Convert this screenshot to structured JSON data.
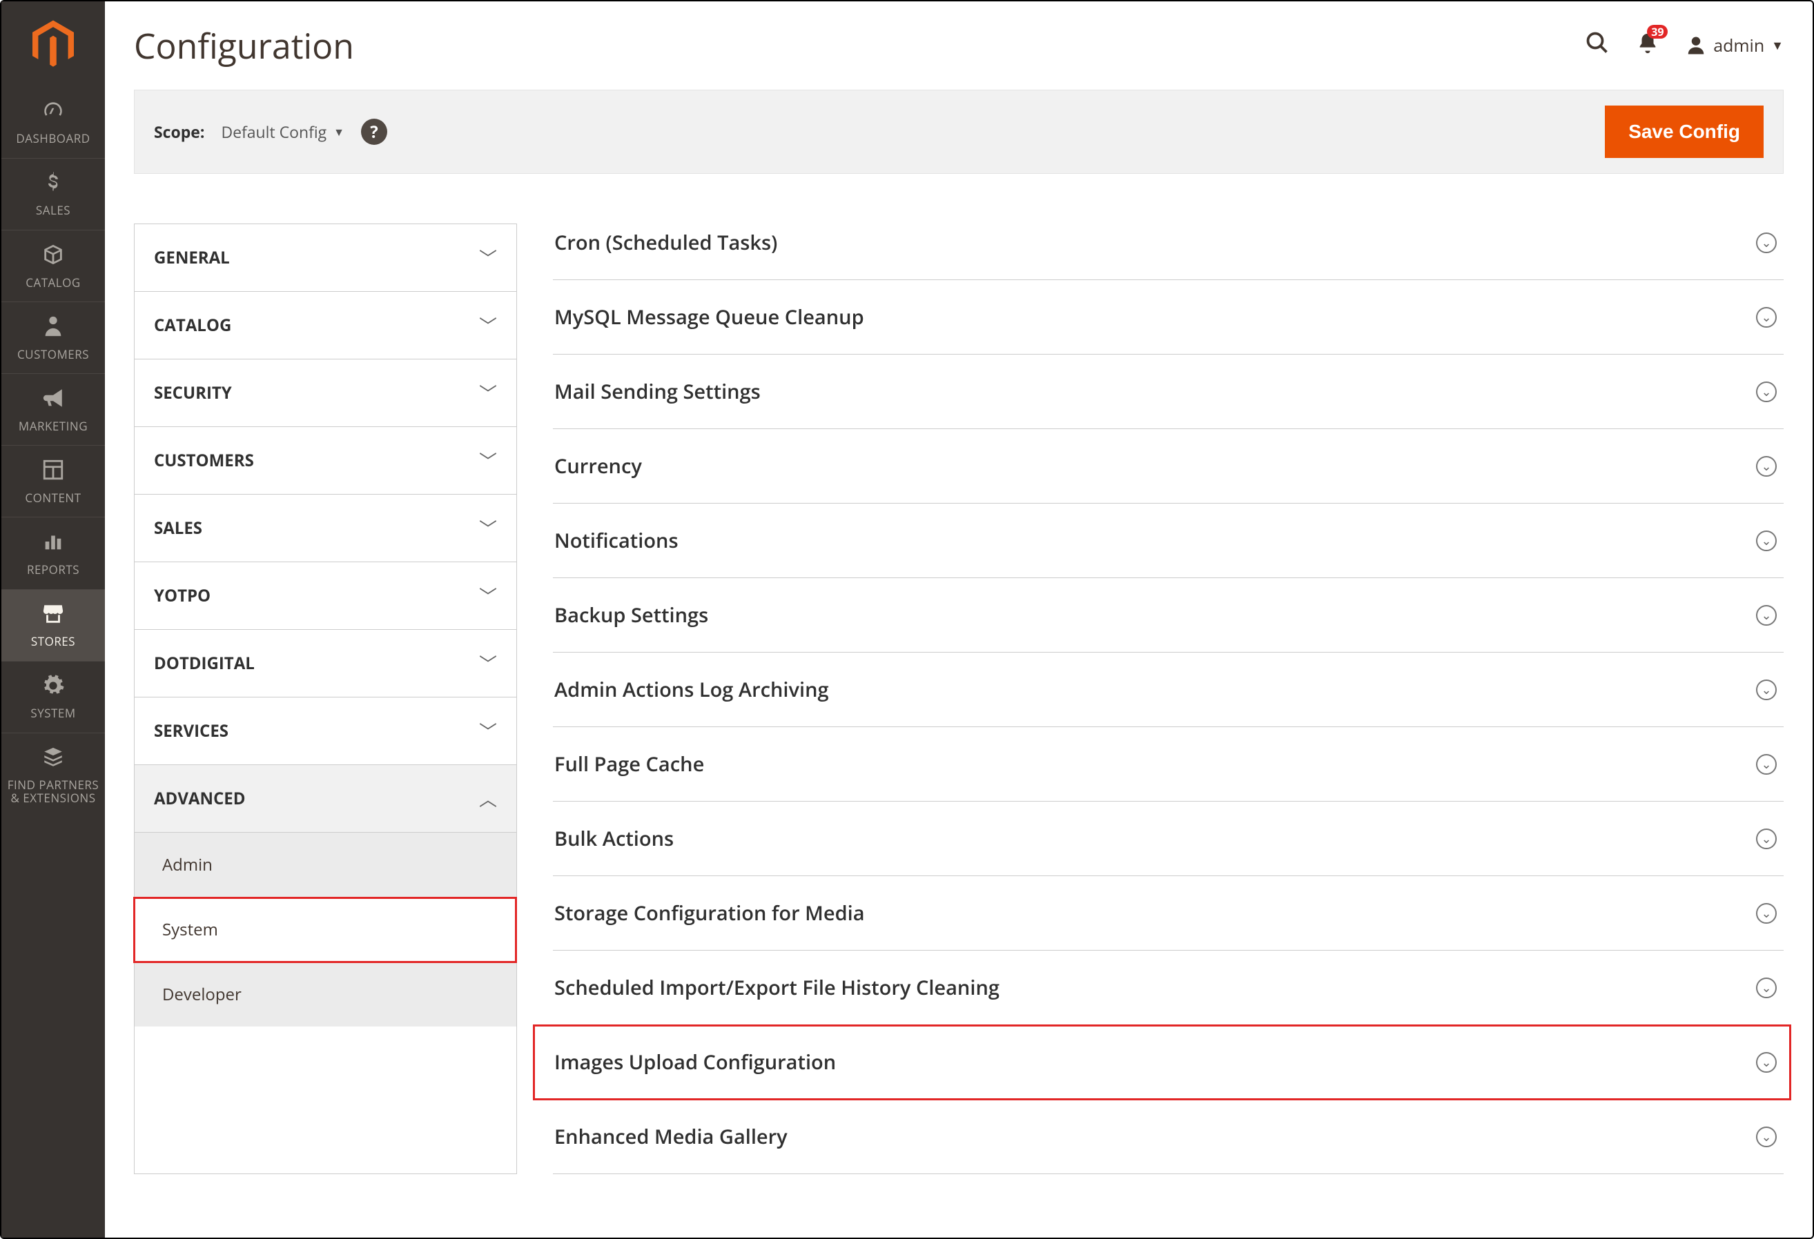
{
  "sidebar": {
    "items": [
      {
        "label": "DASHBOARD",
        "icon": "dashboard"
      },
      {
        "label": "SALES",
        "icon": "dollar"
      },
      {
        "label": "CATALOG",
        "icon": "box"
      },
      {
        "label": "CUSTOMERS",
        "icon": "person"
      },
      {
        "label": "MARKETING",
        "icon": "megaphone"
      },
      {
        "label": "CONTENT",
        "icon": "layout"
      },
      {
        "label": "REPORTS",
        "icon": "bars"
      },
      {
        "label": "STORES",
        "icon": "storefront"
      },
      {
        "label": "SYSTEM",
        "icon": "gear"
      },
      {
        "label": "FIND PARTNERS & EXTENSIONS",
        "icon": "stack"
      }
    ],
    "active_index": 7
  },
  "header": {
    "title": "Configuration",
    "notification_count": "39",
    "username": "admin"
  },
  "scope": {
    "label": "Scope:",
    "selected": "Default Config",
    "help_char": "?",
    "save_label": "Save Config"
  },
  "config_tabs": [
    {
      "label": "GENERAL",
      "expanded": false
    },
    {
      "label": "CATALOG",
      "expanded": false
    },
    {
      "label": "SECURITY",
      "expanded": false
    },
    {
      "label": "CUSTOMERS",
      "expanded": false
    },
    {
      "label": "SALES",
      "expanded": false
    },
    {
      "label": "YOTPO",
      "expanded": false
    },
    {
      "label": "DOTDIGITAL",
      "expanded": false
    },
    {
      "label": "SERVICES",
      "expanded": false
    },
    {
      "label": "ADVANCED",
      "expanded": true
    }
  ],
  "advanced_subitems": [
    {
      "label": "Admin",
      "selected": false,
      "highlighted": false
    },
    {
      "label": "System",
      "selected": true,
      "highlighted": true
    },
    {
      "label": "Developer",
      "selected": false,
      "highlighted": false
    }
  ],
  "sections": [
    {
      "title": "Cron (Scheduled Tasks)",
      "highlighted": false
    },
    {
      "title": "MySQL Message Queue Cleanup",
      "highlighted": false
    },
    {
      "title": "Mail Sending Settings",
      "highlighted": false
    },
    {
      "title": "Currency",
      "highlighted": false
    },
    {
      "title": "Notifications",
      "highlighted": false
    },
    {
      "title": "Backup Settings",
      "highlighted": false
    },
    {
      "title": "Admin Actions Log Archiving",
      "highlighted": false
    },
    {
      "title": "Full Page Cache",
      "highlighted": false
    },
    {
      "title": "Bulk Actions",
      "highlighted": false
    },
    {
      "title": "Storage Configuration for Media",
      "highlighted": false
    },
    {
      "title": "Scheduled Import/Export File History Cleaning",
      "highlighted": false
    },
    {
      "title": "Images Upload Configuration",
      "highlighted": true
    },
    {
      "title": "Enhanced Media Gallery",
      "highlighted": false
    }
  ]
}
